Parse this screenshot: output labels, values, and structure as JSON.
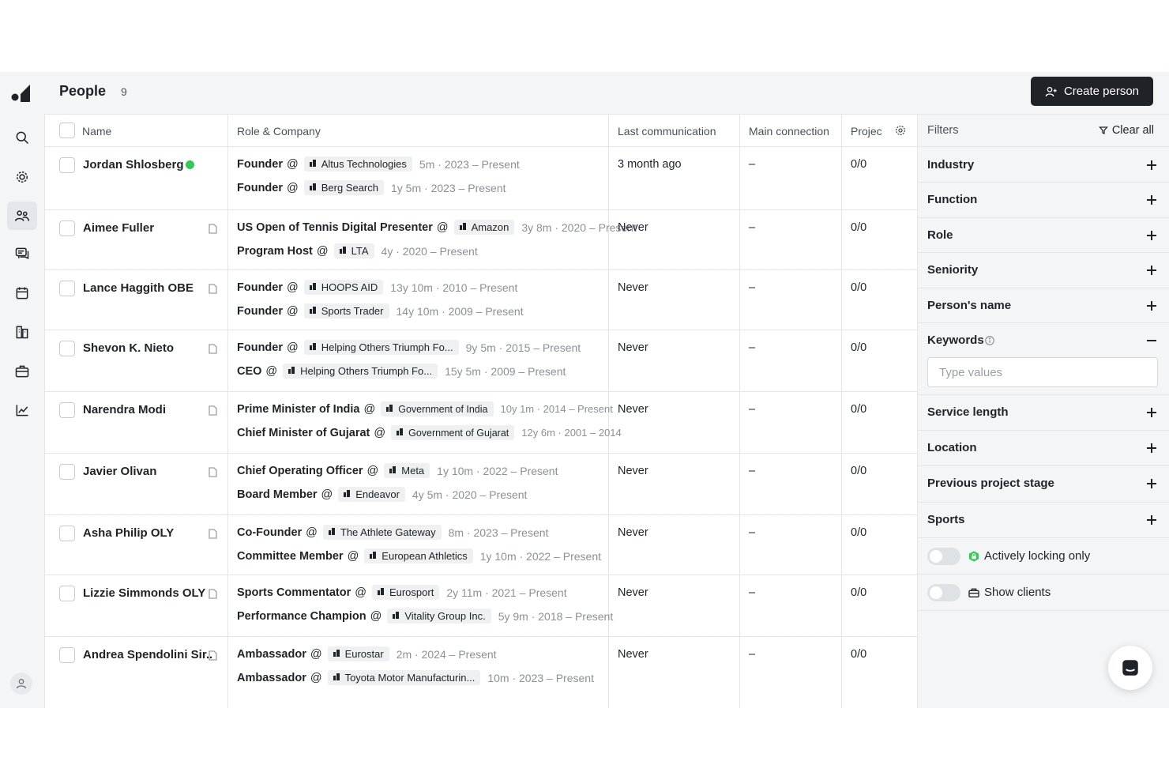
{
  "header": {
    "title": "People",
    "count": "9",
    "create_label": "Create person"
  },
  "rail": {
    "items": [
      "search-icon",
      "settings-icon",
      "people-icon",
      "messages-icon",
      "calendar-icon",
      "buildings-icon",
      "briefcase-icon",
      "chart-icon"
    ],
    "active": "people-icon"
  },
  "table": {
    "columns": {
      "name": "Name",
      "role": "Role & Company",
      "last": "Last communication",
      "main": "Main connection",
      "project": "Projec"
    },
    "rows": [
      {
        "name": "Jordan Shlosberg",
        "last": "3 month ago",
        "main": "–",
        "project": "0/0",
        "roles": [
          {
            "title": "Founder",
            "company": "Altus Technologies",
            "duration": "5m · 2023 – Present"
          },
          {
            "title": "Founder",
            "company": "Berg Search",
            "duration": "1y 5m · 2023 – Present"
          }
        ]
      },
      {
        "name": "Aimee Fuller",
        "last": "Never",
        "main": "–",
        "project": "0/0",
        "roles": [
          {
            "title": "US Open of Tennis Digital Presenter",
            "company": "Amazon",
            "duration": "3y 8m · 2020 – Present"
          },
          {
            "title": "Program Host",
            "company": "LTA",
            "duration": "4y · 2020 – Present"
          }
        ]
      },
      {
        "name": "Lance Haggith OBE",
        "last": "Never",
        "main": "–",
        "project": "0/0",
        "roles": [
          {
            "title": "Founder",
            "company": "HOOPS AID",
            "duration": "13y 10m · 2010 – Present"
          },
          {
            "title": "Founder",
            "company": "Sports Trader",
            "duration": "14y 10m · 2009 – Present"
          }
        ]
      },
      {
        "name": "Shevon K. Nieto",
        "last": "Never",
        "main": "–",
        "project": "0/0",
        "roles": [
          {
            "title": "Founder",
            "company": "Helping Others Triumph Fo...",
            "duration": "9y 5m · 2015 – Present"
          },
          {
            "title": "CEO",
            "company": "Helping Others Triumph Fo...",
            "duration": "15y 5m · 2009 – Present"
          }
        ]
      },
      {
        "name": "Narendra Modi",
        "last": "Never",
        "main": "–",
        "project": "0/0",
        "roles": [
          {
            "title": "Prime Minister of India",
            "company": "Government of India",
            "duration": "10y 1m · 2014 – Present"
          },
          {
            "title": "Chief Minister of Gujarat",
            "company": "Government of Gujarat",
            "duration": "12y 6m · 2001 – 2014"
          }
        ]
      },
      {
        "name": "Javier Olivan",
        "last": "Never",
        "main": "–",
        "project": "0/0",
        "roles": [
          {
            "title": "Chief Operating Officer",
            "company": "Meta",
            "duration": "1y 10m · 2022 – Present"
          },
          {
            "title": "Board Member",
            "company": "Endeavor",
            "duration": "4y 5m · 2020 – Present"
          }
        ]
      },
      {
        "name": "Asha Philip OLY",
        "last": "Never",
        "main": "–",
        "project": "0/0",
        "roles": [
          {
            "title": "Co-Founder",
            "company": "The Athlete Gateway",
            "duration": "8m · 2023 – Present"
          },
          {
            "title": "Committee Member",
            "company": "European Athletics",
            "duration": "1y 10m · 2022 – Present"
          }
        ]
      },
      {
        "name": "Lizzie Simmonds OLY",
        "last": "Never",
        "main": "–",
        "project": "0/0",
        "roles": [
          {
            "title": "Sports Commentator",
            "company": "Eurosport",
            "duration": "2y 11m · 2021 – Present"
          },
          {
            "title": "Performance Champion",
            "company": "Vitality Group Inc.",
            "duration": "5y 9m · 2018 – Present"
          }
        ]
      },
      {
        "name": "Andrea Spendolini Sir..",
        "last": "Never",
        "main": "–",
        "project": "0/0",
        "roles": [
          {
            "title": "Ambassador",
            "company": "Eurostar",
            "duration": "2m · 2024 – Present"
          },
          {
            "title": "Ambassador",
            "company": "Toyota Motor Manufacturin...",
            "duration": "10m · 2023 – Present"
          }
        ]
      }
    ]
  },
  "filters": {
    "title": "Filters",
    "clear_label": "Clear all",
    "items": [
      "Industry",
      "Function",
      "Role",
      "Seniority",
      "Person's name",
      "Keywords",
      "Service length",
      "Location",
      "Previous project stage",
      "Sports"
    ],
    "keywords_placeholder": "Type values",
    "toggles": [
      {
        "label": "Actively locking only",
        "on": false
      },
      {
        "label": "Show clients",
        "on": false
      }
    ]
  },
  "colors": {
    "primary_button": "#1f2328",
    "online": "#2ecc52",
    "lock_icon": "#2ecc52"
  }
}
